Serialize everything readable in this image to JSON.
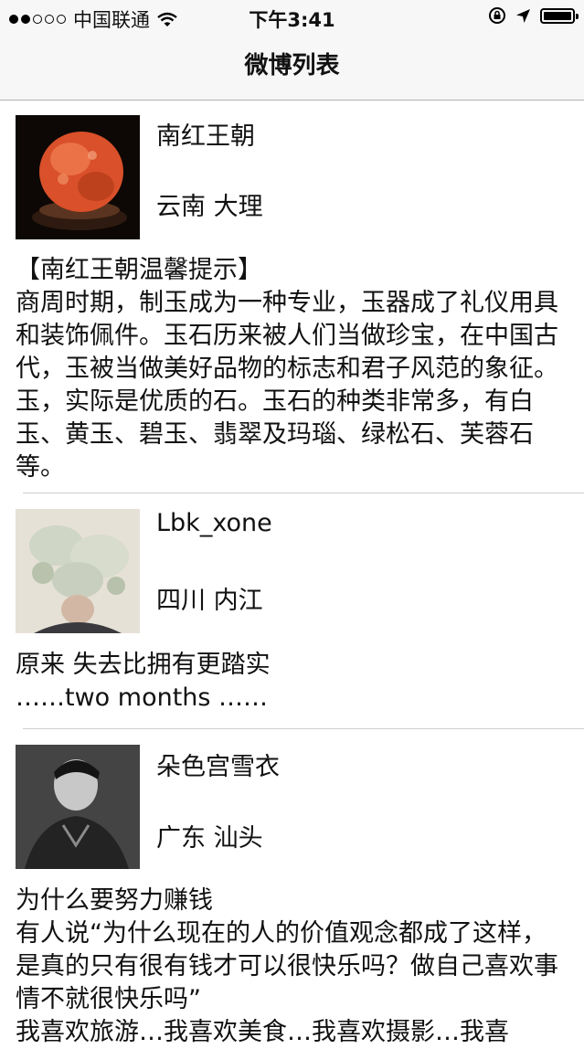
{
  "status_bar": {
    "carrier": "中国联通",
    "time": "下午3:41"
  },
  "nav": {
    "title": "微博列表"
  },
  "posts": [
    {
      "name": "南红王朝",
      "location": "云南 大理",
      "text": "【南红王朝温馨提示】\n商周时期，制玉成为一种专业，玉器成了礼仪用具和装饰佩件。玉石历来被人们当做珍宝，在中国古代，玉被当做美好品物的标志和君子风范的象征。玉，实际是优质的石。玉石的种类非常多，有白玉、黄玉、碧玉、翡翠及玛瑙、绿松石、芙蓉石等。"
    },
    {
      "name": "Lbk_xone",
      "location": "四川 内江",
      "text": "原来 失去比拥有更踏实\n……two months ……"
    },
    {
      "name": "朵色宫雪衣",
      "location": "广东 汕头",
      "text": "为什么要努力赚钱\n有人说“为什么现在的人的价值观念都成了这样，是真的只有很有钱才可以很快乐吗？做自己喜欢事情不就很快乐吗”\n我喜欢旅游…我喜欢美食…我喜欢摄影…我喜"
    }
  ]
}
